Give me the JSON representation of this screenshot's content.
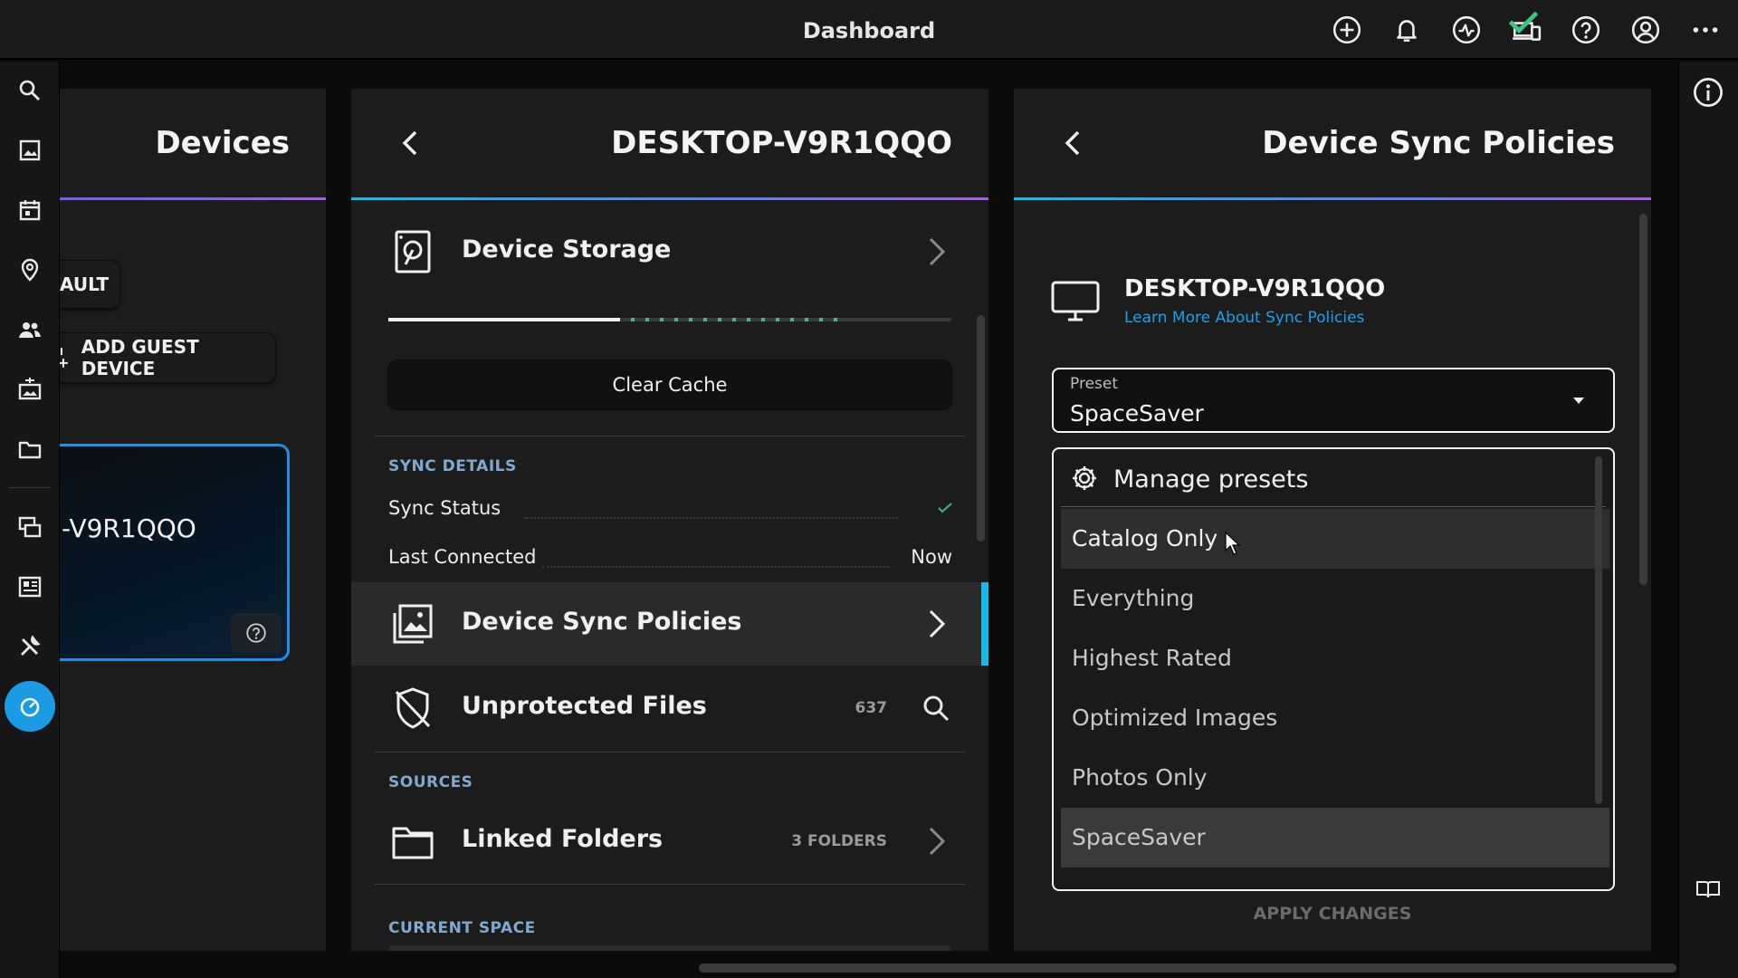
{
  "app": {
    "title": "Dashboard"
  },
  "topbar": {
    "icons": [
      "add-circle-icon",
      "bell-icon",
      "activity-icon",
      "devices-icon",
      "help-icon",
      "account-icon",
      "more-icon"
    ]
  },
  "rail": {
    "icons": [
      "search-icon",
      "image-icon",
      "calendar-icon",
      "location-pin-icon",
      "people-icon",
      "import-icon",
      "folder-icon",
      "collections-icon",
      "grid-icon",
      "tools-icon",
      "dashboard-gauge-icon"
    ],
    "active": "dashboard-gauge-icon",
    "accent": "#1a9be6"
  },
  "devices_panel": {
    "title": "Devices",
    "vault_pill": "AULT",
    "add_guest_label": "ADD GUEST DEVICE",
    "card_name": "-V9R1QQO"
  },
  "device_panel": {
    "title": "DESKTOP-V9R1QQO",
    "storage_label": "Device Storage",
    "clear_cache_label": "Clear Cache",
    "sync_details_label": "SYNC DETAILS",
    "sync_status_label": "Sync Status",
    "last_connected_label": "Last Connected",
    "last_connected_value": "Now",
    "sync_policies_label": "Device Sync Policies",
    "unprotected_label": "Unprotected Files",
    "unprotected_count": "637",
    "sources_label": "SOURCES",
    "linked_folders_label": "Linked Folders",
    "linked_folders_count": "3 FOLDERS",
    "current_space_label": "CURRENT SPACE"
  },
  "policies_panel": {
    "title": "Device Sync Policies",
    "device_name": "DESKTOP-V9R1QQO",
    "learn_more": "Learn More About Sync Policies",
    "preset_label": "Preset",
    "preset_value": "SpaceSaver",
    "manage_presets": "Manage presets",
    "options": [
      "Catalog Only",
      "Everything",
      "Highest Rated",
      "Optimized Images",
      "Photos Only",
      "SpaceSaver"
    ],
    "hovered_option": "Catalog Only",
    "selected_option": "SpaceSaver",
    "apply_label": "APPLY CHANGES",
    "link_color": "#1ea0f0"
  }
}
